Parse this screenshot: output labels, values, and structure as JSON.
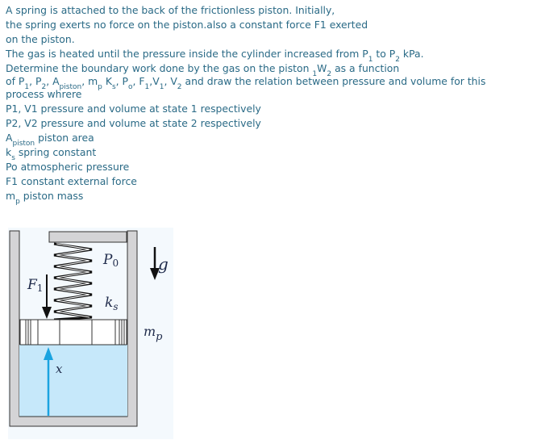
{
  "problem": {
    "line1": "A spring is attached to the back of the frictionless piston. Initially,",
    "line2": "the spring exerts no force on the piston.also a constant force F1 exerted",
    "line3": "on the piston.",
    "line4_pre": "The gas is heated until the pressure inside the cylinder increased from P",
    "line4_sub1": "1",
    "line4_mid": " to P",
    "line4_sub2": "2",
    "line4_post": " kPa.",
    "line5_pre": " Determine the boundary work done by the gas on the piston ",
    "line5_presub": "1",
    "line5_w": "W",
    "line5_sub": "2",
    "line5_post": " as a function",
    "line6": {
      "t0": "of P",
      "s0": "1",
      "t1": ", P",
      "s1": "2",
      "t2": ", A",
      "s2": "piston",
      "t3": ", m",
      "s3": "p",
      "t4": " K",
      "s4": "s",
      "t5": ", P",
      "s5": "o",
      "t6": ", F",
      "s6": "1",
      "t7": ",V",
      "s7": "1",
      "t8": ", V",
      "s8": "2",
      "t9": "  and draw the relation between pressure and volume for this"
    },
    "line7": "process whrere"
  },
  "definitions": [
    {
      "symbol": "P1, V1",
      "sub": "",
      "text": " pressure and volume at state 1 respectively"
    },
    {
      "symbol": "P2, V2",
      "sub": "",
      "text": " pressure and volume at state 2 respectively"
    },
    {
      "symbol": "A",
      "sub": "piston",
      "text": "  piston area"
    },
    {
      "symbol": "k",
      "sub": "s",
      "text": " spring constant"
    },
    {
      "symbol": "Po",
      "sub": "",
      "text": " atmospheric pressure"
    },
    {
      "symbol": "F1",
      "sub": "",
      "text": " constant external force"
    },
    {
      "symbol": "m",
      "sub": "p",
      "text": " piston mass"
    }
  ],
  "diagram": {
    "labels": {
      "atmospheric_pressure": "P",
      "atmospheric_pressure_sub": "0",
      "force": "F",
      "force_sub": "1",
      "spring": "k",
      "spring_sub": "s",
      "gravity": "g",
      "mass": "m",
      "mass_sub": "p",
      "displacement": "x"
    },
    "colors": {
      "wall": "#d4d4d6",
      "gas": "#c6e8fa",
      "arrow_x": "#1aa3e0",
      "outline": "#222222"
    }
  }
}
